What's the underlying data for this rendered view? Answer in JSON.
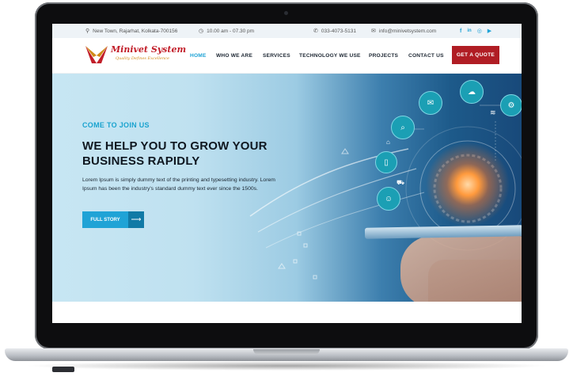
{
  "topbar": {
    "address": "New Town, Rajarhat, Kolkata-700156",
    "hours": "10.00 am - 07.30 pm",
    "phone": "033-4073-5131",
    "email": "info@minivetsystem.com",
    "social": [
      "f",
      "in",
      "ig",
      "yt"
    ]
  },
  "logo": {
    "name": "Minivet System",
    "tagline": "Quality Defines Excellence"
  },
  "nav": {
    "items": [
      "HOME",
      "WHO WE ARE",
      "SERVICES",
      "TECHNOLOGY WE USE",
      "PROJECTS",
      "CONTACT US"
    ],
    "active": "HOME",
    "cta": "GET A QUOTE"
  },
  "hero": {
    "subtitle": "COME TO JOIN US",
    "title": "WE HELP YOU TO GROW YOUR BUSINESS RAPIDLY",
    "text": "Lorem Ipsum is simply dummy text of the printing and typesetting industry. Lorem Ipsum has been the industry's standard dummy text ever since the 1500s.",
    "button": "FULL STORY",
    "button_arrow": "⟶"
  },
  "icons": {
    "location": "map-pin-icon",
    "clock": "clock-icon",
    "phone": "phone-icon",
    "email": "envelope-icon"
  },
  "colors": {
    "accent": "#1fa3d6",
    "cta": "#b01d24",
    "logo_red": "#c21f2a",
    "logo_gold": "#d08a18",
    "title": "#0f1720"
  }
}
